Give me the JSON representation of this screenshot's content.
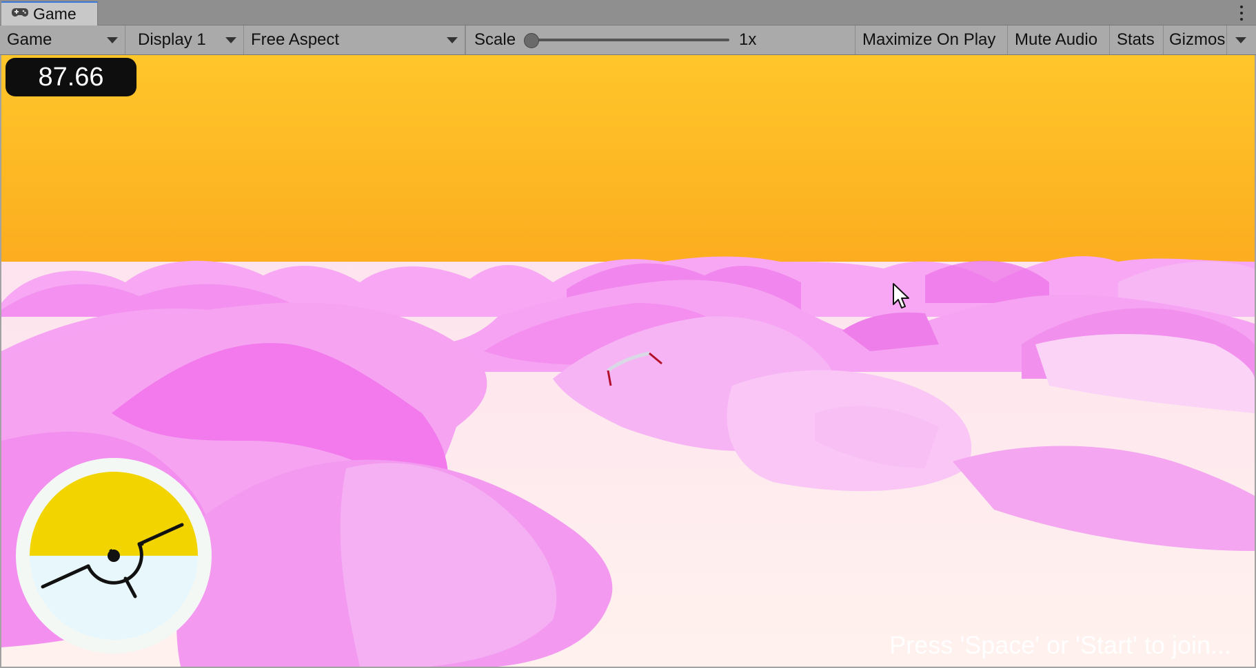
{
  "window": {
    "tab_title": "Game",
    "tab_icon": "gamepad-icon",
    "menu_icon": "kebab-menu-icon"
  },
  "toolbar": {
    "view_mode": "Game",
    "display": "Display 1",
    "aspect": "Free Aspect",
    "scale_label": "Scale",
    "scale_value": "1x",
    "scale_slider_level": 0,
    "maximize_on_play": "Maximize On Play",
    "mute_audio": "Mute Audio",
    "stats": "Stats",
    "gizmos": "Gizmos"
  },
  "game": {
    "timer": "87.66",
    "prompt": "Press 'Space' or 'Start' to join...",
    "colors": {
      "sky_top": "#ffc62a",
      "sky_bottom": "#fbaa1e",
      "terrain_pink": "#f58cf0",
      "terrain_light": "#fde8ef",
      "attitude_sky": "#f2d400",
      "attitude_ground": "#e8f7fb"
    },
    "icons": {
      "attitude_indicator": "attitude-indicator-icon",
      "cursor": "mouse-cursor-icon",
      "glider": "glider-icon"
    }
  }
}
